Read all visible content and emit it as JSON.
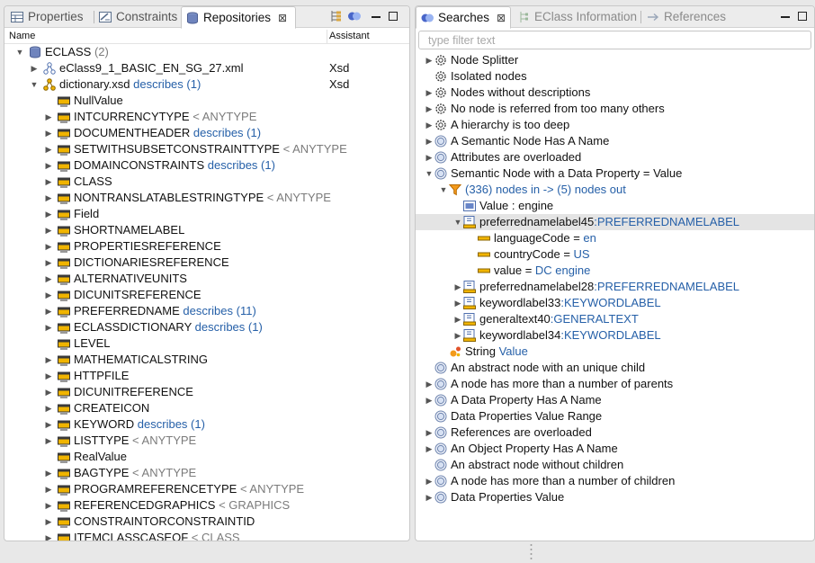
{
  "left_tabs": [
    {
      "label": "Properties",
      "icon": "properties-icon"
    },
    {
      "label": "Constraints",
      "icon": "constraints-icon"
    },
    {
      "label": "Repositories",
      "icon": "repositories-icon",
      "close": "⊠"
    }
  ],
  "right_tabs": [
    {
      "label": "Searches",
      "icon": "searches-icon",
      "close": "⊠"
    },
    {
      "label": "EClass Information",
      "icon": "eclass-info-icon"
    },
    {
      "label": "References",
      "icon": "references-icon"
    }
  ],
  "columns": {
    "name": "Name",
    "assistant": "Assistant"
  },
  "filter_placeholder": "type filter text",
  "colors": {
    "link": "#2660a8",
    "gray": "#7b7b7b",
    "selection": "#e4e4e4",
    "folder": "#f0b400"
  },
  "repo_tree": [
    {
      "indent": 0,
      "tw": "open",
      "icon": "database-icon",
      "name": "ECLASS",
      "link": "",
      "gray": "(2)",
      "assistant": ""
    },
    {
      "indent": 1,
      "tw": "closed",
      "icon": "xml-schema-icon",
      "name": "eClass9_1_BASIC_EN_SG_27.xml",
      "link": "",
      "gray": "",
      "assistant": "Xsd"
    },
    {
      "indent": 1,
      "tw": "open",
      "icon": "xsd-dictionary-icon",
      "name": "dictionary.xsd",
      "link": "describes (1)",
      "gray": "",
      "assistant": "Xsd"
    },
    {
      "indent": 2,
      "tw": "",
      "icon": "type-icon",
      "name": "NullValue",
      "link": "",
      "gray": "",
      "assistant": ""
    },
    {
      "indent": 2,
      "tw": "closed",
      "icon": "type-icon",
      "name": "INTCURRENCYTYPE",
      "link": "",
      "gray": "< ANYTYPE",
      "assistant": ""
    },
    {
      "indent": 2,
      "tw": "closed",
      "icon": "type-icon",
      "name": "DOCUMENTHEADER",
      "link": "describes (1)",
      "gray": "",
      "assistant": ""
    },
    {
      "indent": 2,
      "tw": "closed",
      "icon": "type-icon",
      "name": "SETWITHSUBSETCONSTRAINTTYPE",
      "link": "",
      "gray": "< ANYTYPE",
      "assistant": ""
    },
    {
      "indent": 2,
      "tw": "closed",
      "icon": "type-icon",
      "name": "DOMAINCONSTRAINTS",
      "link": "describes (1)",
      "gray": "",
      "assistant": ""
    },
    {
      "indent": 2,
      "tw": "closed",
      "icon": "type-icon",
      "name": "CLASS",
      "link": "",
      "gray": "",
      "assistant": ""
    },
    {
      "indent": 2,
      "tw": "closed",
      "icon": "type-icon",
      "name": "NONTRANSLATABLESTRINGTYPE",
      "link": "",
      "gray": "< ANYTYPE",
      "assistant": ""
    },
    {
      "indent": 2,
      "tw": "closed",
      "icon": "type-icon",
      "name": "Field",
      "link": "",
      "gray": "",
      "assistant": ""
    },
    {
      "indent": 2,
      "tw": "closed",
      "icon": "type-icon",
      "name": "SHORTNAMELABEL",
      "link": "",
      "gray": "",
      "assistant": ""
    },
    {
      "indent": 2,
      "tw": "closed",
      "icon": "type-icon",
      "name": "PROPERTIESREFERENCE",
      "link": "",
      "gray": "",
      "assistant": ""
    },
    {
      "indent": 2,
      "tw": "closed",
      "icon": "type-icon",
      "name": "DICTIONARIESREFERENCE",
      "link": "",
      "gray": "",
      "assistant": ""
    },
    {
      "indent": 2,
      "tw": "closed",
      "icon": "type-icon",
      "name": "ALTERNATIVEUNITS",
      "link": "",
      "gray": "",
      "assistant": ""
    },
    {
      "indent": 2,
      "tw": "closed",
      "icon": "type-icon",
      "name": "DICUNITSREFERENCE",
      "link": "",
      "gray": "",
      "assistant": ""
    },
    {
      "indent": 2,
      "tw": "closed",
      "icon": "type-icon",
      "name": "PREFERREDNAME",
      "link": "describes (11)",
      "gray": "",
      "assistant": ""
    },
    {
      "indent": 2,
      "tw": "closed",
      "icon": "type-icon",
      "name": "ECLASSDICTIONARY",
      "link": "describes (1)",
      "gray": "",
      "assistant": ""
    },
    {
      "indent": 2,
      "tw": "",
      "icon": "type-icon",
      "name": "LEVEL",
      "link": "",
      "gray": "",
      "assistant": ""
    },
    {
      "indent": 2,
      "tw": "closed",
      "icon": "type-icon",
      "name": "MATHEMATICALSTRING",
      "link": "",
      "gray": "",
      "assistant": ""
    },
    {
      "indent": 2,
      "tw": "closed",
      "icon": "type-icon",
      "name": "HTTPFILE",
      "link": "",
      "gray": "",
      "assistant": ""
    },
    {
      "indent": 2,
      "tw": "closed",
      "icon": "type-icon",
      "name": "DICUNITREFERENCE",
      "link": "",
      "gray": "",
      "assistant": ""
    },
    {
      "indent": 2,
      "tw": "closed",
      "icon": "type-icon",
      "name": "CREATEICON",
      "link": "",
      "gray": "",
      "assistant": ""
    },
    {
      "indent": 2,
      "tw": "closed",
      "icon": "type-icon",
      "name": "KEYWORD",
      "link": "describes (1)",
      "gray": "",
      "assistant": ""
    },
    {
      "indent": 2,
      "tw": "closed",
      "icon": "type-icon",
      "name": "LISTTYPE",
      "link": "",
      "gray": "< ANYTYPE",
      "assistant": ""
    },
    {
      "indent": 2,
      "tw": "",
      "icon": "type-icon",
      "name": "RealValue",
      "link": "",
      "gray": "",
      "assistant": ""
    },
    {
      "indent": 2,
      "tw": "closed",
      "icon": "type-icon",
      "name": "BAGTYPE",
      "link": "",
      "gray": "< ANYTYPE",
      "assistant": ""
    },
    {
      "indent": 2,
      "tw": "closed",
      "icon": "type-icon",
      "name": "PROGRAMREFERENCETYPE",
      "link": "",
      "gray": "< ANYTYPE",
      "assistant": ""
    },
    {
      "indent": 2,
      "tw": "closed",
      "icon": "type-icon",
      "name": "REFERENCEDGRAPHICS",
      "link": "",
      "gray": "< GRAPHICS",
      "assistant": ""
    },
    {
      "indent": 2,
      "tw": "closed",
      "icon": "type-icon",
      "name": "CONSTRAINTORCONSTRAINTID",
      "link": "",
      "gray": "",
      "assistant": ""
    },
    {
      "indent": 2,
      "tw": "closed",
      "icon": "type-icon",
      "name": "ITEMCLASSCASEOF",
      "link": "",
      "gray": "< CLASS",
      "assistant": ""
    }
  ],
  "search_tree": [
    {
      "indent": 0,
      "tw": "closed",
      "icon": "gear-icon",
      "pre": "",
      "name": "Node Splitter",
      "link": "",
      "sel": false
    },
    {
      "indent": 0,
      "tw": "",
      "icon": "gear-icon",
      "pre": "",
      "name": "Isolated nodes",
      "link": "",
      "sel": false
    },
    {
      "indent": 0,
      "tw": "closed",
      "icon": "gear-icon",
      "pre": "",
      "name": "Nodes without descriptions",
      "link": "",
      "sel": false
    },
    {
      "indent": 0,
      "tw": "closed",
      "icon": "gear-icon",
      "pre": "",
      "name": "No node is referred from too many others",
      "link": "",
      "sel": false
    },
    {
      "indent": 0,
      "tw": "closed",
      "icon": "gear-icon",
      "pre": "",
      "name": "A hierarchy is too deep",
      "link": "",
      "sel": false
    },
    {
      "indent": 0,
      "tw": "closed",
      "icon": "search-query-icon",
      "pre": "",
      "name": "A Semantic Node Has A Name",
      "link": "",
      "sel": false
    },
    {
      "indent": 0,
      "tw": "closed",
      "icon": "search-query-icon",
      "pre": "",
      "name": "Attributes are overloaded",
      "link": "",
      "sel": false
    },
    {
      "indent": 0,
      "tw": "open",
      "icon": "search-query-icon",
      "pre": "",
      "name": "Semantic Node with a Data Property  = Value",
      "link": "",
      "sel": false
    },
    {
      "indent": 1,
      "tw": "open",
      "icon": "filter-icon",
      "pre": "",
      "name": "",
      "link": "(336) nodes in -> (5) nodes out",
      "sel": false
    },
    {
      "indent": 2,
      "tw": "",
      "icon": "value-icon",
      "pre": "",
      "name": "Value : engine",
      "link": "",
      "sel": false
    },
    {
      "indent": 2,
      "tw": "open",
      "icon": "class-instance-icon",
      "pre": "",
      "name": "preferrednamelabel45",
      "link": ":PREFERREDNAMELABEL",
      "sel": true
    },
    {
      "indent": 3,
      "tw": "",
      "icon": "attribute-icon",
      "pre": "",
      "name": "languageCode = ",
      "link": "en",
      "sel": false
    },
    {
      "indent": 3,
      "tw": "",
      "icon": "attribute-icon",
      "pre": "",
      "name": "countryCode = ",
      "link": "US",
      "sel": false
    },
    {
      "indent": 3,
      "tw": "",
      "icon": "attribute-icon",
      "pre": "",
      "name": "value = ",
      "link": "DC engine",
      "sel": false
    },
    {
      "indent": 2,
      "tw": "closed",
      "icon": "class-instance-icon",
      "pre": "",
      "name": "preferrednamelabel28",
      "link": ":PREFERREDNAMELABEL",
      "sel": false
    },
    {
      "indent": 2,
      "tw": "closed",
      "icon": "class-instance-icon",
      "pre": "",
      "name": "keywordlabel33",
      "link": ":KEYWORDLABEL",
      "sel": false
    },
    {
      "indent": 2,
      "tw": "closed",
      "icon": "class-instance-icon",
      "pre": "",
      "name": "generaltext40",
      "link": ":GENERALTEXT",
      "sel": false
    },
    {
      "indent": 2,
      "tw": "closed",
      "icon": "class-instance-icon",
      "pre": "",
      "name": "keywordlabel34",
      "link": ":KEYWORDLABEL",
      "sel": false
    },
    {
      "indent": 1,
      "tw": "",
      "icon": "string-type-icon",
      "pre": "",
      "name": "String ",
      "link": "Value",
      "sel": false
    },
    {
      "indent": 0,
      "tw": "",
      "icon": "search-query-icon",
      "pre": "",
      "name": "An abstract node with an unique child",
      "link": "",
      "sel": false
    },
    {
      "indent": 0,
      "tw": "closed",
      "icon": "search-query-icon",
      "pre": "",
      "name": "A node has more than a number of parents",
      "link": "",
      "sel": false
    },
    {
      "indent": 0,
      "tw": "closed",
      "icon": "search-query-icon",
      "pre": "",
      "name": "A Data Property Has A Name",
      "link": "",
      "sel": false
    },
    {
      "indent": 0,
      "tw": "",
      "icon": "search-query-icon",
      "pre": "",
      "name": "Data Properties Value Range",
      "link": "",
      "sel": false
    },
    {
      "indent": 0,
      "tw": "closed",
      "icon": "search-query-icon",
      "pre": "",
      "name": "References are overloaded",
      "link": "",
      "sel": false
    },
    {
      "indent": 0,
      "tw": "closed",
      "icon": "search-query-icon",
      "pre": "",
      "name": "An Object Property Has A Name",
      "link": "",
      "sel": false
    },
    {
      "indent": 0,
      "tw": "",
      "icon": "search-query-icon",
      "pre": "",
      "name": "An abstract node without children",
      "link": "",
      "sel": false
    },
    {
      "indent": 0,
      "tw": "closed",
      "icon": "search-query-icon",
      "pre": "",
      "name": "A node has more than a number of children",
      "link": "",
      "sel": false
    },
    {
      "indent": 0,
      "tw": "closed",
      "icon": "search-query-icon",
      "pre": "",
      "name": "Data Properties Value",
      "link": "",
      "sel": false
    }
  ]
}
